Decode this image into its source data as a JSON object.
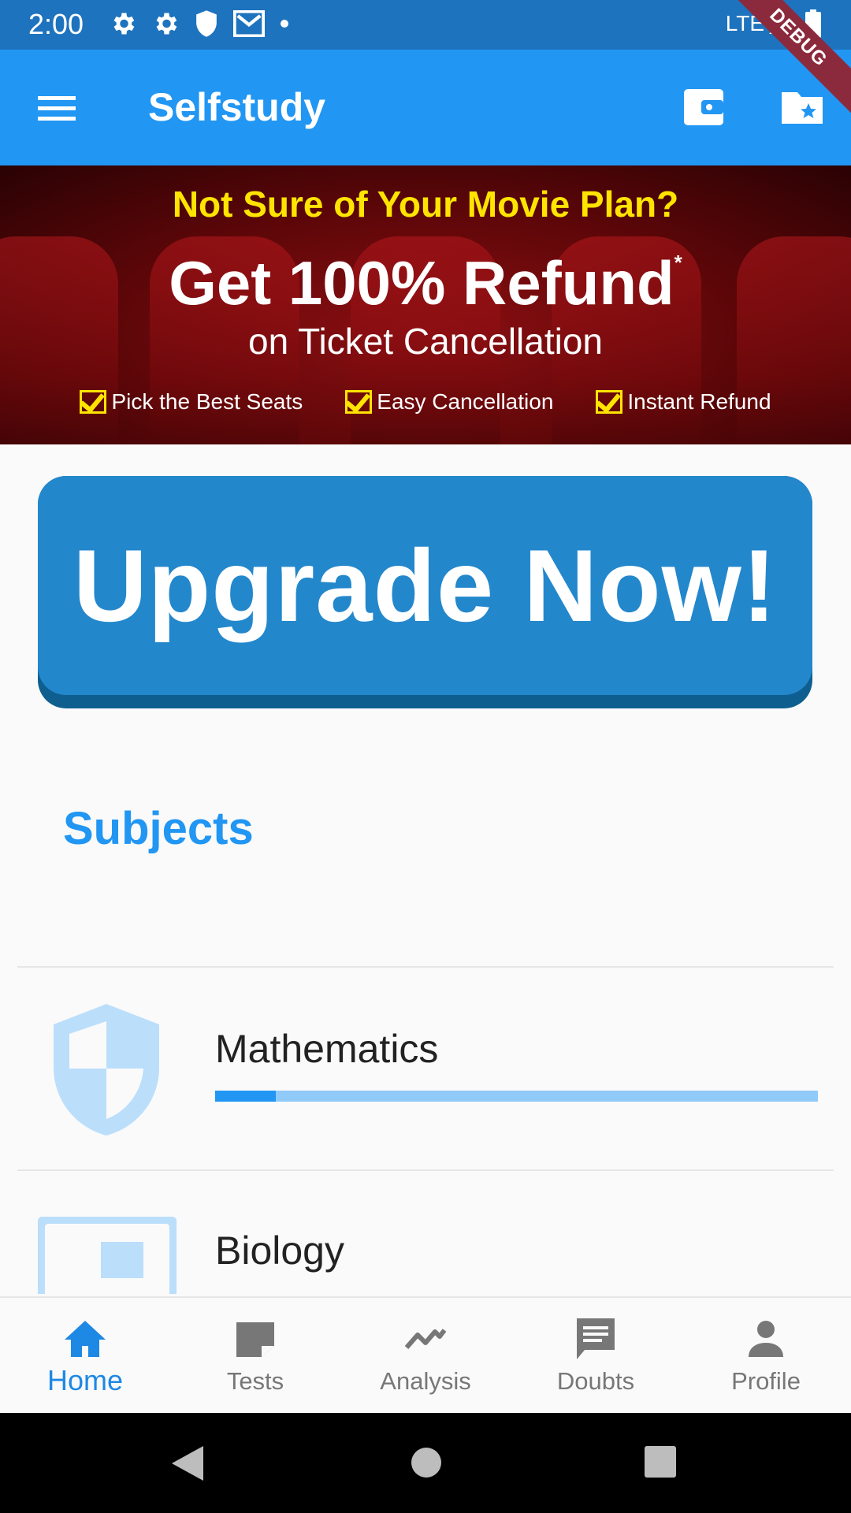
{
  "status_bar": {
    "time": "2:00",
    "network": "LTE",
    "icons": [
      "settings-icon",
      "settings-icon",
      "shield-icon",
      "mail-icon",
      "dot-icon",
      "signal-icon",
      "battery-icon"
    ]
  },
  "debug_banner": "DEBUG",
  "app_bar": {
    "title": "Selfstudy",
    "icons": [
      "menu-icon",
      "wallet-icon",
      "folder-star-icon"
    ]
  },
  "ad_banner": {
    "line1": "Not Sure of Your Movie Plan?",
    "line2": "Get 100% Refund",
    "line2_mark": "*",
    "line3": "on Ticket Cancellation",
    "checks": [
      "Pick the Best Seats",
      "Easy Cancellation",
      "Instant Refund"
    ]
  },
  "upgrade_button": {
    "label": "Upgrade Now!"
  },
  "subjects": {
    "heading": "Subjects",
    "items": [
      {
        "name": "Mathematics",
        "icon": "shield-icon",
        "progress": 0.1
      },
      {
        "name": "Biology",
        "icon": "window-icon"
      }
    ]
  },
  "bottom_nav": {
    "items": [
      {
        "label": "Home",
        "icon": "home-icon",
        "active": true
      },
      {
        "label": "Tests",
        "icon": "note-icon",
        "active": false
      },
      {
        "label": "Analysis",
        "icon": "trending-icon",
        "active": false
      },
      {
        "label": "Doubts",
        "icon": "chat-icon",
        "active": false
      },
      {
        "label": "Profile",
        "icon": "person-icon",
        "active": false
      }
    ]
  },
  "system_nav": [
    "back-icon",
    "home-circle-icon",
    "recents-icon"
  ],
  "colors": {
    "primary": "#2196F3",
    "status_bar": "#1E73BE",
    "progress_fill": "#2196F3",
    "progress_track": "#90CAF9",
    "banner_yellow": "#FFE400"
  }
}
